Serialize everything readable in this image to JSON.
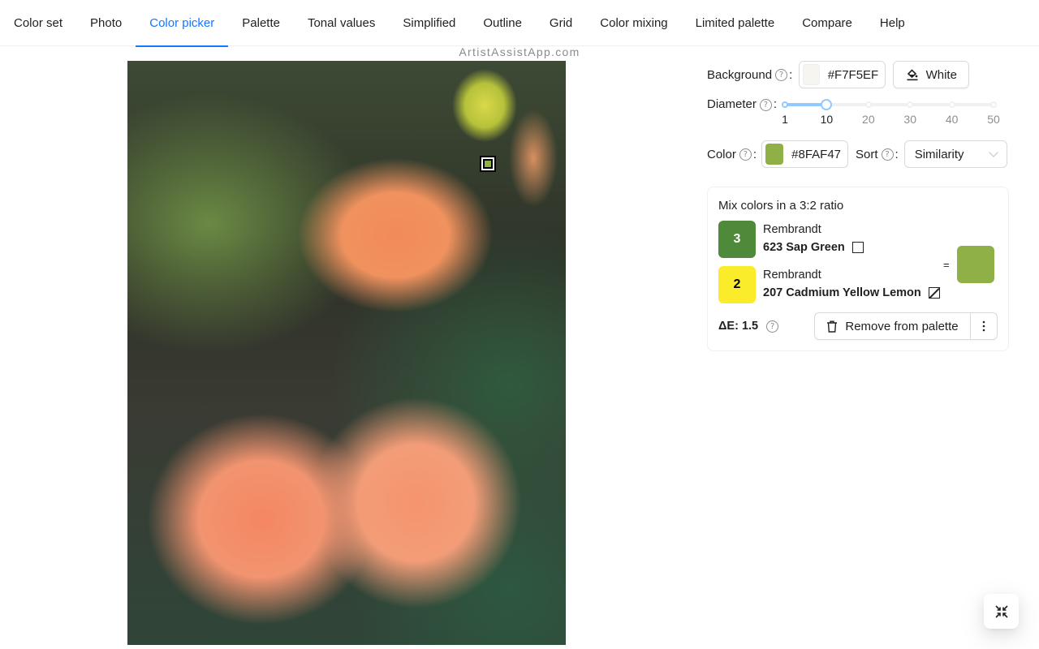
{
  "nav": {
    "tabs": [
      {
        "label": "Color set",
        "active": false
      },
      {
        "label": "Photo",
        "active": false
      },
      {
        "label": "Color picker",
        "active": true
      },
      {
        "label": "Palette",
        "active": false
      },
      {
        "label": "Tonal values",
        "active": false
      },
      {
        "label": "Simplified",
        "active": false
      },
      {
        "label": "Outline",
        "active": false
      },
      {
        "label": "Grid",
        "active": false
      },
      {
        "label": "Color mixing",
        "active": false
      },
      {
        "label": "Limited palette",
        "active": false
      },
      {
        "label": "Compare",
        "active": false
      },
      {
        "label": "Help",
        "active": false
      }
    ]
  },
  "watermark": "ArtistAssistApp.com",
  "photo": {
    "alt": "Photo of orange dahlias with green foliage",
    "marker_icon": "picker-target-icon"
  },
  "panel": {
    "background": {
      "label": "Background",
      "help_icon": "question-circle-icon",
      "colon": ":",
      "value": "#F7F5EF",
      "swatch_color": "#F7F5EF",
      "white_button": {
        "label": "White",
        "icon": "paint-bucket-icon"
      }
    },
    "diameter": {
      "label": "Diameter",
      "help_icon": "question-circle-icon",
      "colon": ":",
      "value": 10,
      "min": 1,
      "max": 50,
      "marks": [
        "1",
        "10",
        "20",
        "30",
        "40",
        "50"
      ]
    },
    "color": {
      "label": "Color",
      "help_icon": "question-circle-icon",
      "colon": ":",
      "value": "#8FAF47",
      "swatch_color": "#8FAF47"
    },
    "sort": {
      "label": "Sort",
      "help_icon": "question-circle-icon",
      "colon": ":",
      "selected": "Similarity"
    }
  },
  "mix_card": {
    "title": "Mix colors in a 3:2 ratio",
    "items": [
      {
        "parts": "3",
        "brand": "Rembrandt",
        "name": "623 Sap Green",
        "swatch_color": "#4E8A3A",
        "text_color": "#ffffff",
        "opacity_icon": "opaque-square-icon"
      },
      {
        "parts": "2",
        "brand": "Rembrandt",
        "name": "207 Cadmium Yellow Lemon",
        "swatch_color": "#FAEC2A",
        "text_color": "#000000",
        "opacity_icon": "semi-opaque-square-icon"
      }
    ],
    "equals": "=",
    "result_color": "#8FAF47",
    "delta_e": "ΔE: 1.5",
    "remove_button": {
      "label": "Remove from palette",
      "icon": "delete-icon"
    },
    "more_button": {
      "icon": "more-vertical-icon"
    }
  },
  "fab": {
    "icon": "compress-icon"
  }
}
